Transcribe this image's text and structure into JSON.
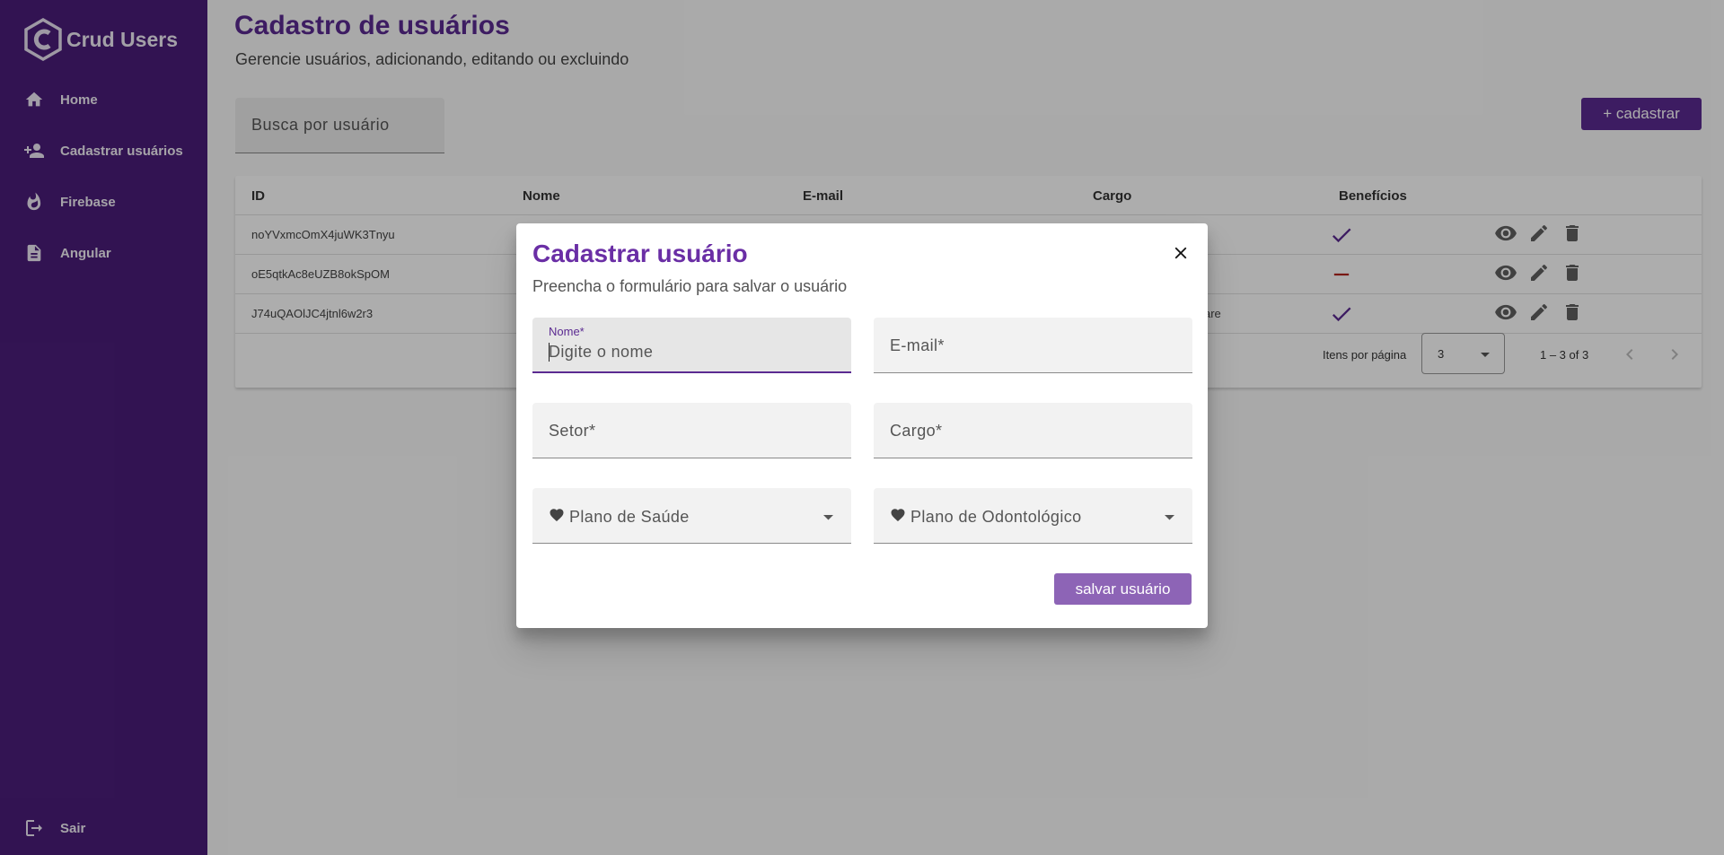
{
  "app": {
    "title": "Crud Users"
  },
  "sidebar": {
    "items": [
      {
        "label": "Home",
        "icon": "home-icon"
      },
      {
        "label": "Cadastrar usuários",
        "icon": "person-add-icon"
      },
      {
        "label": "Firebase",
        "icon": "flame-icon"
      },
      {
        "label": "Angular",
        "icon": "document-icon"
      }
    ],
    "logout": {
      "label": "Sair",
      "icon": "logout-icon"
    }
  },
  "header": {
    "title": "Cadastro de usuários",
    "subtitle": "Gerencie usuários, adicionando, editando ou excluindo"
  },
  "search": {
    "placeholder": "Busca por usuário"
  },
  "toolbar": {
    "add_label": "+ cadastrar"
  },
  "table": {
    "columns": [
      "ID",
      "Nome",
      "E-mail",
      "Cargo",
      "Benefícios"
    ],
    "rows": [
      {
        "id": "noYVxmcOmX4juWK3Tnyu",
        "cargo": "",
        "benefits": "check"
      },
      {
        "id": "oE5qtkAc8eUZB8okSpOM",
        "cargo": "",
        "benefits": "remove"
      },
      {
        "id": "J74uQAOlJC4jtnl6w2r3",
        "cargo": "are",
        "benefits": "check"
      }
    ]
  },
  "paginator": {
    "items_label": "Itens por página",
    "page_size": "3",
    "range": "1 – 3 of 3"
  },
  "dialog": {
    "title": "Cadastrar usuário",
    "subtitle": "Preencha o formulário para salvar o usuário",
    "fields": {
      "nome": {
        "label": "Nome*",
        "placeholder": "Digite o nome",
        "value": ""
      },
      "email": {
        "label": "E-mail*"
      },
      "setor": {
        "label": "Setor*"
      },
      "cargo": {
        "label": "Cargo*"
      },
      "plano_saude": {
        "label": "Plano de Saúde"
      },
      "plano_odonto": {
        "label": "Plano de Odontológico"
      }
    },
    "save_label": "salvar usuário"
  },
  "colors": {
    "sidebar_bg": "#4b1d7a",
    "primary": "#5b2a91",
    "dialog_title": "#6a2ea5",
    "remove": "#b3261e"
  }
}
